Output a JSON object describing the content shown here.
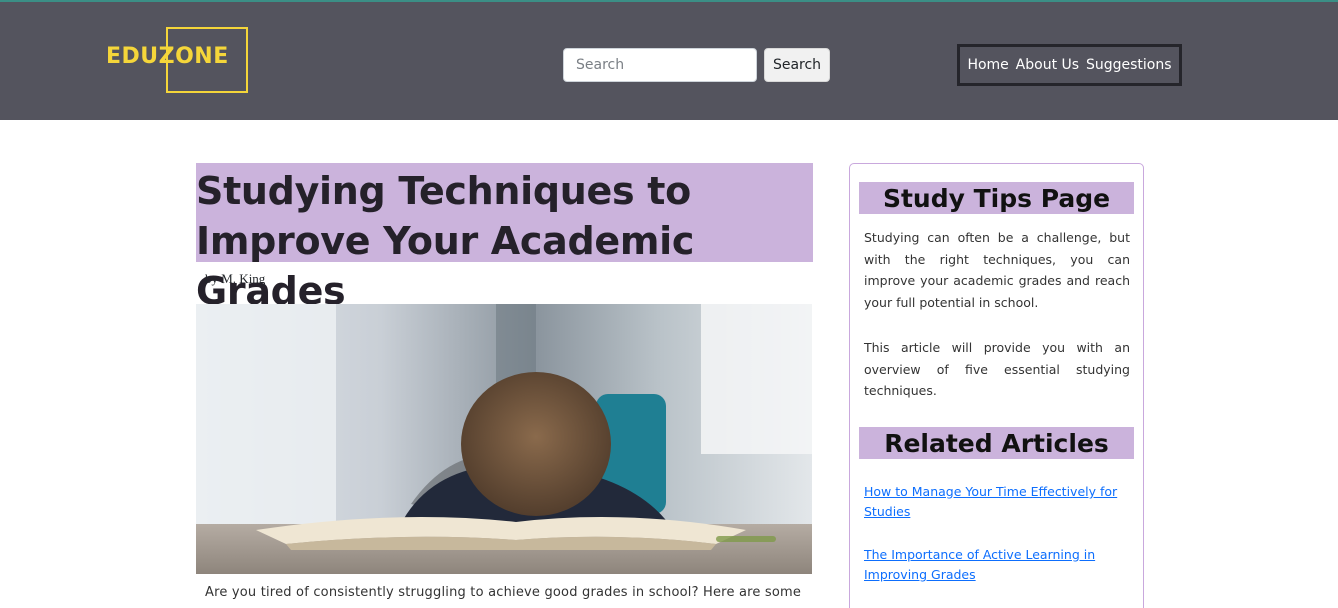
{
  "header": {
    "logo_text": "EDUZONE",
    "search_placeholder": "Search",
    "search_button": "Search",
    "nav": [
      "Home",
      "About Us",
      "Suggestions"
    ]
  },
  "article": {
    "title": "Studying Techniques to Improve Your Academic Grades",
    "byline": "by M. King",
    "intro": "Are you tired of consistently struggling to achieve good grades in school? Here are some"
  },
  "sidebar": {
    "heading": "Study Tips Page",
    "para1": "Studying can often be a challenge, but with the right techniques, you can improve your academic grades and reach your full potential in school.",
    "para2": "This article will provide you with an overview of five essential studying techniques.",
    "related_heading": "Related Articles",
    "links": [
      "How to Manage Your Time Effectively for Studies",
      "The Importance of Active Learning in Improving Grades"
    ]
  },
  "colors": {
    "header_bg": "#54545e",
    "logo": "#f5d63a",
    "highlight": "#cbb3dc",
    "link": "#0d6efd"
  }
}
